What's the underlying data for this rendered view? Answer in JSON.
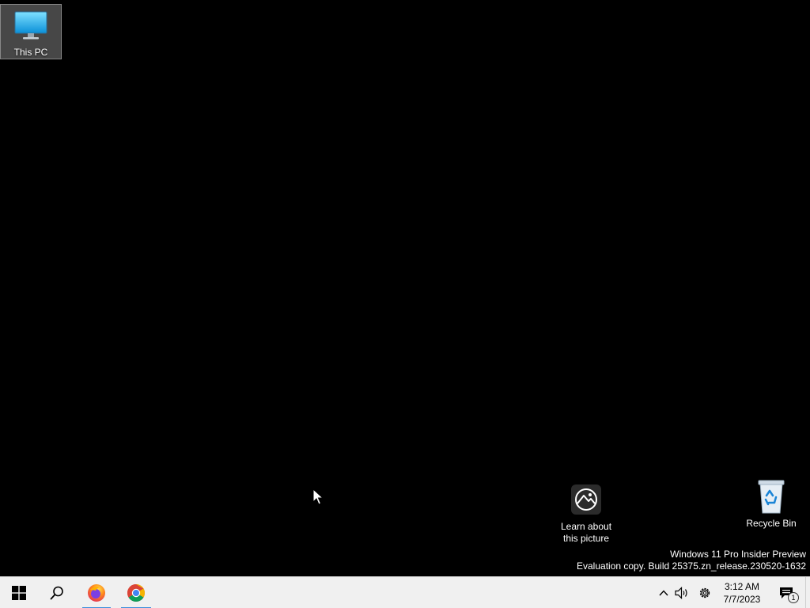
{
  "desktop": {
    "icons": [
      {
        "label": "This PC",
        "icon": "monitor-icon"
      },
      {
        "label": "Learn about\nthis picture",
        "icon": "spotlight-icon"
      },
      {
        "label": "Recycle Bin",
        "icon": "recycle-bin-icon"
      }
    ],
    "watermark": {
      "line1": "Windows 11 Pro Insider Preview",
      "line2": "Evaluation copy. Build 25375.zn_release.230520-1632"
    }
  },
  "taskbar": {
    "items": [
      {
        "icon": "windows-start-icon"
      },
      {
        "icon": "search-icon"
      },
      {
        "icon": "firefox-icon",
        "running": true
      },
      {
        "icon": "chrome-icon",
        "running": true
      }
    ],
    "tray": {
      "icons": [
        "chevron-up-icon",
        "volume-icon",
        "gear-icon"
      ],
      "time": "3:12 AM",
      "date": "7/7/2023",
      "notification_count": "1"
    }
  },
  "colors": {
    "desktop_bg": "#000000",
    "taskbar_bg": "#f0f0f0",
    "accent": "#3b8edb"
  }
}
